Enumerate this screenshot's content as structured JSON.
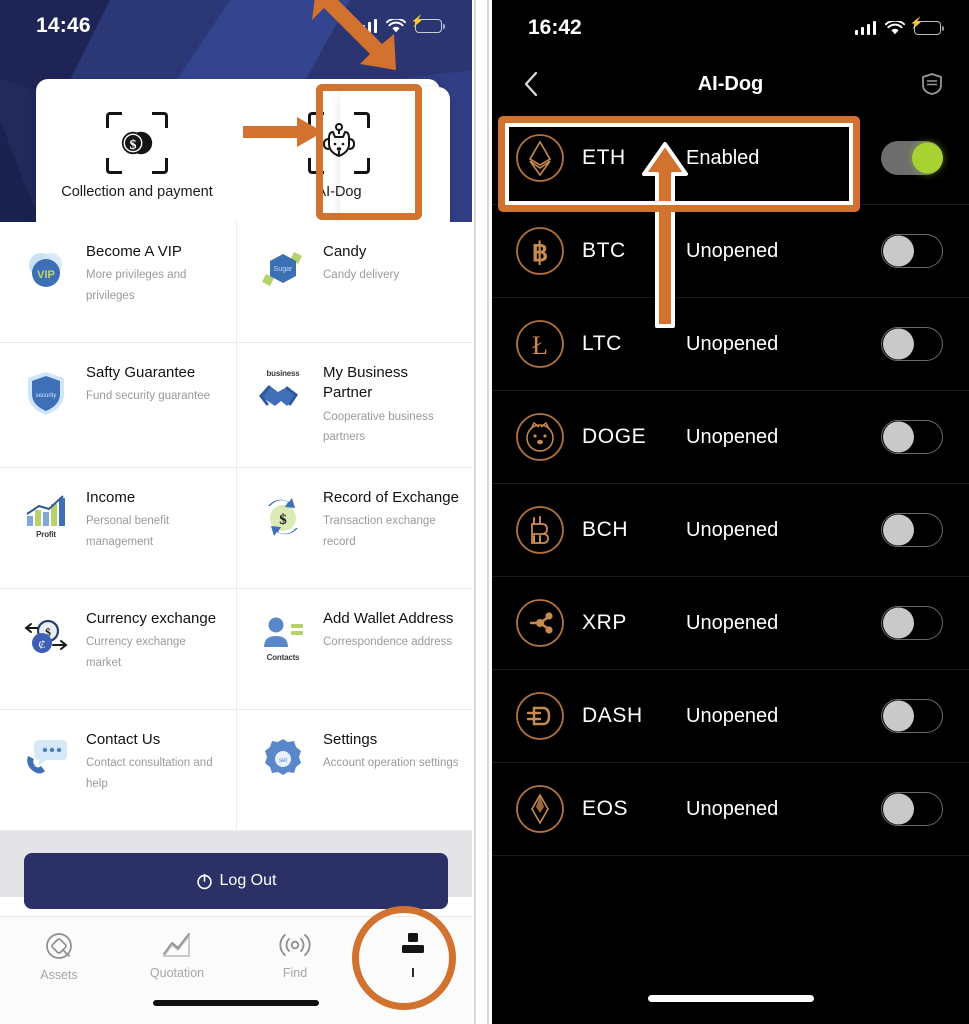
{
  "left_phone": {
    "status_bar": {
      "time": "14:46",
      "signal_icon": "signal-bars-icon",
      "wifi_icon": "wifi-icon",
      "battery_icon": "battery-charging-icon"
    },
    "top_card": {
      "items": [
        {
          "label": "Collection and payment",
          "icon": "scan-dollar-coin-icon"
        },
        {
          "label": "AI-Dog",
          "icon": "scan-dog-face-icon"
        }
      ]
    },
    "menu": [
      {
        "title": "Become A VIP",
        "subtitle": "More privileges and privileges",
        "icon": "vip-badge-icon",
        "icon_caption": "VIP"
      },
      {
        "title": "Candy",
        "subtitle": "Candy delivery",
        "icon": "candy-hexagon-icon",
        "icon_caption": "Sugar"
      },
      {
        "title": "Safty Guarantee",
        "subtitle": "Fund security guarantee",
        "icon": "shield-security-icon",
        "icon_caption": "security"
      },
      {
        "title": "My Business Partner",
        "subtitle": "Cooperative business partners",
        "icon": "handshake-icon",
        "icon_caption": "business"
      },
      {
        "title": "Income",
        "subtitle": "Personal benefit management",
        "icon": "bar-chart-growth-icon",
        "icon_caption": "Profit"
      },
      {
        "title": "Record of Exchange",
        "subtitle": "Transaction exchange record",
        "icon": "exchange-arrows-dollar-icon",
        "icon_caption": ""
      },
      {
        "title": "Currency exchange",
        "subtitle": "Currency exchange market",
        "icon": "currency-swap-icon",
        "icon_caption": ""
      },
      {
        "title": "Add Wallet Address",
        "subtitle": "Correspondence address",
        "icon": "contact-person-icon",
        "icon_caption": "Contacts"
      },
      {
        "title": "Contact Us",
        "subtitle": "Contact consultation and help",
        "icon": "phone-chat-bubble-icon",
        "icon_caption": ""
      },
      {
        "title": "Settings",
        "subtitle": "Account operation settings",
        "icon": "gear-settings-icon",
        "icon_caption": "set"
      }
    ],
    "logout": {
      "label": "Log Out",
      "icon": "power-icon"
    },
    "tabbar": [
      {
        "label": "Assets",
        "icon": "assets-diamond-icon",
        "active": false
      },
      {
        "label": "Quotation",
        "icon": "line-chart-icon",
        "active": false
      },
      {
        "label": "Find",
        "icon": "radar-signal-icon",
        "active": false
      },
      {
        "label": "I",
        "icon": "person-profile-icon",
        "active": true
      }
    ]
  },
  "right_phone": {
    "status_bar": {
      "time": "16:42",
      "signal_icon": "signal-bars-icon",
      "wifi_icon": "wifi-icon",
      "battery_icon": "battery-charging-icon"
    },
    "nav": {
      "title": "AI-Dog",
      "back_icon": "chevron-left-icon",
      "action_icon": "shield-badge-icon"
    },
    "coins": [
      {
        "symbol": "ETH",
        "status": "Enabled",
        "enabled": true,
        "icon": "ethereum-icon"
      },
      {
        "symbol": "BTC",
        "status": "Unopened",
        "enabled": false,
        "icon": "bitcoin-icon"
      },
      {
        "symbol": "LTC",
        "status": "Unopened",
        "enabled": false,
        "icon": "litecoin-icon"
      },
      {
        "symbol": "DOGE",
        "status": "Unopened",
        "enabled": false,
        "icon": "dogecoin-icon"
      },
      {
        "symbol": "BCH",
        "status": "Unopened",
        "enabled": false,
        "icon": "bitcoin-cash-icon"
      },
      {
        "symbol": "XRP",
        "status": "Unopened",
        "enabled": false,
        "icon": "ripple-icon"
      },
      {
        "symbol": "DASH",
        "status": "Unopened",
        "enabled": false,
        "icon": "dash-icon"
      },
      {
        "symbol": "EOS",
        "status": "Unopened",
        "enabled": false,
        "icon": "eos-icon"
      }
    ]
  },
  "annotations": {
    "color": "#d2722f",
    "highlight_ai_dog": "AI-Dog tile highlight box",
    "highlight_eth": "ETH row highlight box",
    "highlight_profile_tab": "Profile tab circle highlight",
    "arrows": [
      "arrow-to-ai-dog",
      "arrow-to-profile-tab",
      "arrow-to-eth-row"
    ]
  },
  "colors": {
    "accent_orange": "#d2722f",
    "navy": "#27306a",
    "toggle_on": "#a8d132",
    "dark_bg": "#000000",
    "coin_icon": "#c97f4a"
  }
}
